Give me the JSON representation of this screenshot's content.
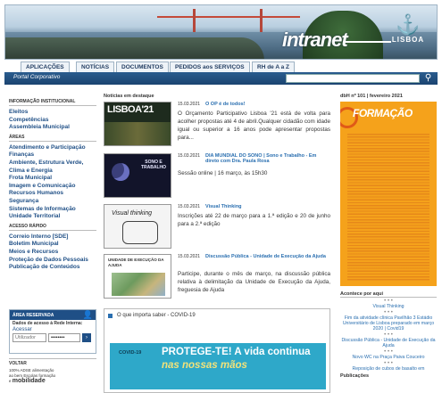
{
  "brand": {
    "intranet": "intranet",
    "city": "LISBOA"
  },
  "nav": {
    "tabs": [
      "APLICAÇÕES",
      "NOTÍCIAS",
      "DOCUMENTOS",
      "PEDIDOS aos SERVIÇOS",
      "RH de A a Z"
    ]
  },
  "portal": {
    "label": "Portal Corporativo"
  },
  "sidebar": {
    "institutional_head": "INFORMAÇÃO INSTITUCIONAL",
    "institutional": [
      "Eleitos",
      "Competências",
      "Assembleia Municipal"
    ],
    "areas_head": "ÁREAS",
    "areas": [
      "Atendimento e Participação",
      "Finanças",
      "Ambiente, Estrutura Verde, Clima e Energia",
      "Frota Municipal",
      "Imagem e Comunicação",
      "Recursos Humanos",
      "Segurança",
      "Sistemas de Informação",
      "Unidade Territorial"
    ],
    "quick_head": "ACESSO RÁPIDO",
    "quick": [
      "Correio Interno [SDE]",
      "Boletim Municipal",
      "Meios e Recursos",
      "Proteção de Dados Pessoais",
      "Publicação de Conteúdos"
    ]
  },
  "login": {
    "title": "ÁREA RESERVADA",
    "subtitle": "Dados de acesso à Rede Interna:",
    "acessar": "Acessar",
    "user_placeholder": "Utilizador",
    "password_mask": "••••••••"
  },
  "voltar": {
    "title": "VOLTAR",
    "cloud": [
      "100%",
      "ADSE",
      "alimentação",
      "ao",
      "bem",
      "Escolas",
      "formação",
      "e",
      "mobilidade"
    ]
  },
  "news": {
    "head": "Notícias em destaque",
    "items": [
      {
        "date": "15.03.2021",
        "title": "O OP é de todos!",
        "body": "O Orçamento Participativo Lisboa '21 está de volta para acolher propostas até 4 de abril.Qualquer cidadão com idade igual ou superior a 16 anos pode apresentar propostas para...",
        "thumb_text": "LISBOA'21"
      },
      {
        "date": "15.03.2021",
        "title": "DIA MUNDIAL DO SONO | Sono e Trabalho - Em direto com Dra. Paula Rosa",
        "body": "Sessão online | 16 março, às 15h30",
        "thumb_text": "SONO E TRABALHO"
      },
      {
        "date": "15.03.2021",
        "title": "Visual Thinking",
        "body": "Inscrições até 22 de março para a 1.ª edição e 20 de junho para a 2.ª edição",
        "thumb_text": "Visual thinking"
      },
      {
        "date": "15.03.2021",
        "title": "Discussão Pública - Unidade de Execução da Ajuda",
        "body": "Participe, durante o mês de março, na discussão pública relativa à delimitação da Unidade de Execução da Ajuda, freguesia de Ajuda",
        "thumb_text": "UNIDADE DE EXECUÇÃO DA AJUDA"
      }
    ]
  },
  "covid": {
    "head": "O que importa saber - COVID-19",
    "tag": "COVID-19",
    "line1": "PROTEGE-TE! A vida continua",
    "line2": "nas nossas mãos"
  },
  "right": {
    "issue": "dbH nº 101 | fevereiro 2021",
    "poster_title": "FORMAÇÃO",
    "acc_head": "Acontece por aqui",
    "links": [
      "Visual Thinking",
      "Fim da atividade clínica Pavilhão 3 Estádio Universitário de Lisboa preparado em março 2020 | Covid19",
      "Discussão Pública - Unidade de Execução da Ajuda",
      "Novo WC na Praça Paiva Couceiro",
      "Reposição de cubos de basalto em"
    ],
    "pub": "Publicações"
  },
  "colors": {
    "accent": "#1f4f86",
    "link": "#2a6fb0",
    "poster": "#f5a21b"
  }
}
